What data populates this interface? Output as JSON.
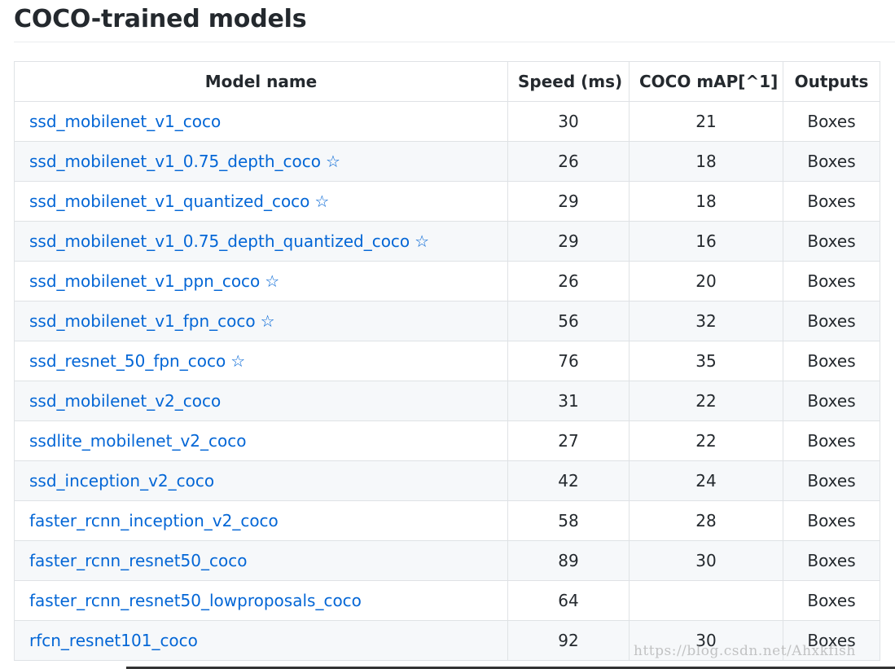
{
  "page": {
    "heading": "COCO-trained models",
    "watermark": "https://blog.csdn.net/Ahxkfish"
  },
  "table": {
    "headers": {
      "model_name": "Model name",
      "speed": "Speed (ms)",
      "map": "COCO mAP[^1]",
      "outputs": "Outputs"
    },
    "rows": [
      {
        "name": "ssd_mobilenet_v1_coco",
        "star": false,
        "speed": "30",
        "map": "21",
        "outputs": "Boxes"
      },
      {
        "name": "ssd_mobilenet_v1_0.75_depth_coco",
        "star": true,
        "speed": "26",
        "map": "18",
        "outputs": "Boxes"
      },
      {
        "name": "ssd_mobilenet_v1_quantized_coco",
        "star": true,
        "speed": "29",
        "map": "18",
        "outputs": "Boxes"
      },
      {
        "name": "ssd_mobilenet_v1_0.75_depth_quantized_coco",
        "star": true,
        "speed": "29",
        "map": "16",
        "outputs": "Boxes"
      },
      {
        "name": "ssd_mobilenet_v1_ppn_coco",
        "star": true,
        "speed": "26",
        "map": "20",
        "outputs": "Boxes"
      },
      {
        "name": "ssd_mobilenet_v1_fpn_coco",
        "star": true,
        "speed": "56",
        "map": "32",
        "outputs": "Boxes"
      },
      {
        "name": "ssd_resnet_50_fpn_coco",
        "star": true,
        "speed": "76",
        "map": "35",
        "outputs": "Boxes"
      },
      {
        "name": "ssd_mobilenet_v2_coco",
        "star": false,
        "speed": "31",
        "map": "22",
        "outputs": "Boxes"
      },
      {
        "name": "ssdlite_mobilenet_v2_coco",
        "star": false,
        "speed": "27",
        "map": "22",
        "outputs": "Boxes"
      },
      {
        "name": "ssd_inception_v2_coco",
        "star": false,
        "speed": "42",
        "map": "24",
        "outputs": "Boxes"
      },
      {
        "name": "faster_rcnn_inception_v2_coco",
        "star": false,
        "speed": "58",
        "map": "28",
        "outputs": "Boxes"
      },
      {
        "name": "faster_rcnn_resnet50_coco",
        "star": false,
        "speed": "89",
        "map": "30",
        "outputs": "Boxes"
      },
      {
        "name": "faster_rcnn_resnet50_lowproposals_coco",
        "star": false,
        "speed": "64",
        "map": "",
        "outputs": "Boxes"
      },
      {
        "name": "rfcn_resnet101_coco",
        "star": false,
        "speed": "92",
        "map": "30",
        "outputs": "Boxes"
      }
    ]
  },
  "colors": {
    "link": "#0366d6",
    "text": "#24292e",
    "border": "#dfe2e5",
    "stripe": "#f6f8fa"
  },
  "icons": {
    "star": "☆"
  }
}
